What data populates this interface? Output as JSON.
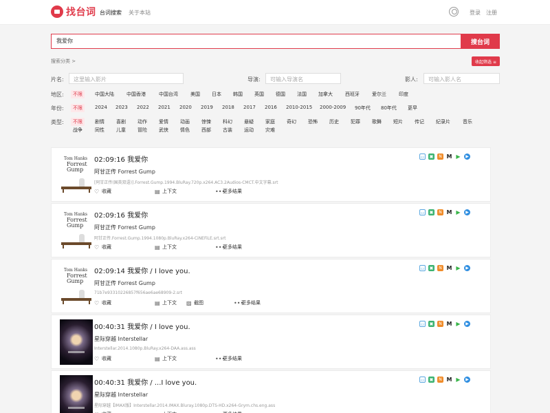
{
  "header": {
    "logo_text": "找台词",
    "nav": [
      "台词搜索",
      "关于本站"
    ],
    "login": "登录",
    "register": "注册"
  },
  "search": {
    "value": "我爱你",
    "button": "搜台词",
    "category_link": "搜索分类 >",
    "collapse_button": "收起筛选 ≡"
  },
  "filters": {
    "film_label": "片名:",
    "film_placeholder": "这里输入影片",
    "director_label": "导演:",
    "director_placeholder": "可输入导演名",
    "actor_label": "影人:",
    "actor_placeholder": "可输入影人名",
    "region_label": "地区:",
    "regions": [
      "不限",
      "中国大陆",
      "中国香港",
      "中国台湾",
      "美国",
      "日本",
      "韩国",
      "英国",
      "德国",
      "法国",
      "加拿大",
      "西班牙",
      "爱尔兰",
      "印度"
    ],
    "year_label": "年份:",
    "years": [
      "不限",
      "2024",
      "2023",
      "2022",
      "2021",
      "2020",
      "2019",
      "2018",
      "2017",
      "2016",
      "2010-2015",
      "2000-2009",
      "90年代",
      "80年代",
      "更早"
    ],
    "type_label": "类型:",
    "types_row1": [
      "不限",
      "剧情",
      "喜剧",
      "动作",
      "爱情",
      "动画",
      "惊悚",
      "科幻",
      "悬疑",
      "家庭",
      "奇幻",
      "恐怖",
      "历史",
      "犯罪",
      "歌舞",
      "短片",
      "传记",
      "纪录片",
      "音乐"
    ],
    "types_row2": [
      "战争",
      "同性",
      "儿童",
      "冒险",
      "武侠",
      "情色",
      "西部",
      "古装",
      "运动",
      "灾难"
    ]
  },
  "poster_text": {
    "fg_small": "Tom Hanks",
    "fg_title_1": "Forrest",
    "fg_title_2": "Gump"
  },
  "actions": {
    "favorite": "收藏",
    "context": "上下文",
    "screenshot": "截图",
    "more": "更多结果"
  },
  "results": [
    {
      "time": "02:09:16",
      "line": "我爱你",
      "title": "阿甘正传 Forrest Gump",
      "file": "[阿甘正传(国英双语)].Forrest.Gump.1994.BluRay.720p.x264.AC3.2Audios-CMCT.中文字幕.srt",
      "poster": "fg",
      "has_screenshot": false
    },
    {
      "time": "02:09:16",
      "line": "我爱你",
      "title": "阿甘正传 Forrest Gump",
      "file": "阿甘正传.Forrest.Gump.1994.1080p.BluRay.x264-CiNEFiLE.srt.srt",
      "poster": "fg",
      "has_screenshot": false
    },
    {
      "time": "02:09:14",
      "line": "我爱你 / I love you.",
      "title": "阿甘正传 Forrest Gump",
      "file": "71b7e93310226857f656ae6ae68909-2.srt",
      "poster": "fg",
      "has_screenshot": true
    },
    {
      "time": "00:40:31",
      "line": "我爱你 / I love you.",
      "title": "星际穿越 Interstellar",
      "file": "Interstellar.2014.1080p.BluRay.x264-DAA.ass.ass",
      "poster": "is",
      "has_screenshot": false
    },
    {
      "time": "00:40:31",
      "line": "我爱你 / ...I love you.",
      "title": "星际穿越 Interstellar",
      "file": "星际穿越【IMAX版】Interstellar.2014.IMAX.Bluray.1080p.DTS-HD.x264-Grym.chs.eng.ass",
      "poster": "is",
      "has_screenshot": false
    }
  ]
}
